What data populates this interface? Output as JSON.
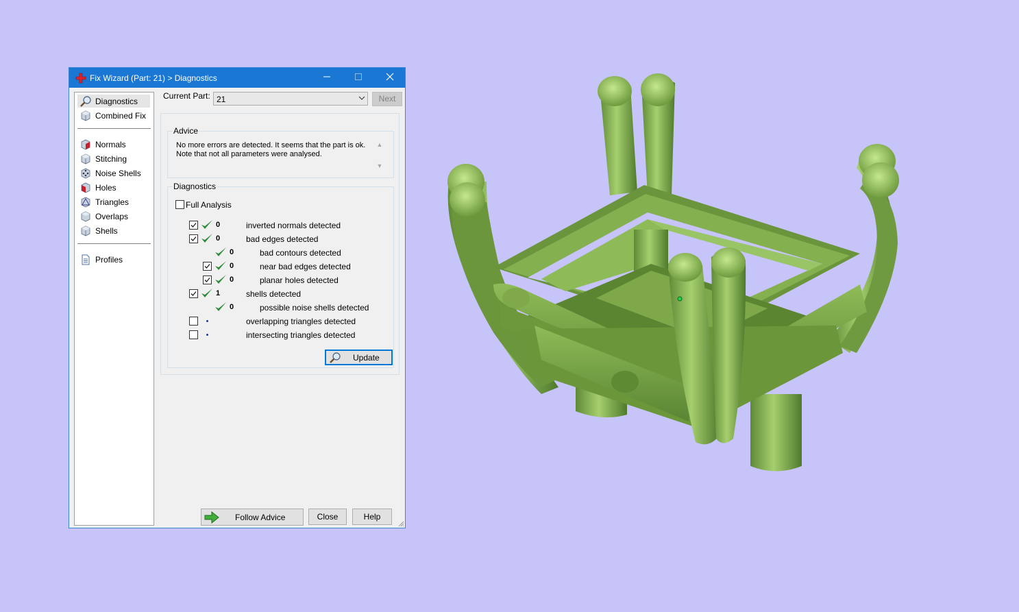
{
  "window": {
    "title": "Fix Wizard (Part: 21) > Diagnostics",
    "app_icon": "red-cross-icon",
    "minimize_icon": "minimize-icon",
    "maximize_icon": "maximize-icon",
    "close_icon": "close-icon"
  },
  "sidebar": {
    "items": [
      {
        "label": "Diagnostics",
        "icon": "magnifier-icon",
        "selected": true
      },
      {
        "label": "Combined Fix",
        "icon": "cube-icon"
      },
      {
        "label": "Normals",
        "icon": "cube-red-face-icon"
      },
      {
        "label": "Stitching",
        "icon": "cube-icon"
      },
      {
        "label": "Noise Shells",
        "icon": "cube-dots-icon"
      },
      {
        "label": "Holes",
        "icon": "cube-red-face-icon"
      },
      {
        "label": "Triangles",
        "icon": "cube-triangle-icon"
      },
      {
        "label": "Overlaps",
        "icon": "cube-icon"
      },
      {
        "label": "Shells",
        "icon": "cube-icon"
      },
      {
        "label": "Profiles",
        "icon": "document-icon"
      }
    ]
  },
  "header": {
    "current_part_label": "Current Part:",
    "current_part_value": "21",
    "next_label": "Next"
  },
  "advice": {
    "caption": "Advice",
    "line1": "No more errors are detected. It seems that the part is ok.",
    "line2": "Note that not all parameters were analysed."
  },
  "diagnostics": {
    "caption": "Diagnostics",
    "full_analysis_label": "Full Analysis",
    "full_analysis_checked": false,
    "rows": [
      {
        "checked": true,
        "status": "ok",
        "count": "0",
        "text": "inverted normals detected"
      },
      {
        "checked": true,
        "status": "ok",
        "count": "0",
        "text": "bad edges detected"
      },
      {
        "status": "ok",
        "count": "0",
        "text": "bad contours detected"
      },
      {
        "checked": true,
        "status": "ok",
        "count": "0",
        "text": "near bad edges detected"
      },
      {
        "checked": true,
        "status": "ok",
        "count": "0",
        "text": "planar holes detected"
      },
      {
        "checked": true,
        "status": "ok",
        "count": "1",
        "text": "shells detected"
      },
      {
        "status": "ok",
        "count": "0",
        "text": "possible noise shells detected"
      },
      {
        "checked": false,
        "status": "not-analysed",
        "count": "",
        "text": "overlapping triangles detected"
      },
      {
        "checked": false,
        "status": "not-analysed",
        "count": "",
        "text": "intersecting triangles detected"
      }
    ],
    "update_label": "Update"
  },
  "footer": {
    "follow_advice_label": "Follow Advice",
    "close_label": "Close",
    "help_label": "Help"
  },
  "colors": {
    "background": "#c6c4f9",
    "titlebar": "#1a78d4",
    "model_green": "#7aa24a",
    "check_green": "#2e8b3a"
  }
}
